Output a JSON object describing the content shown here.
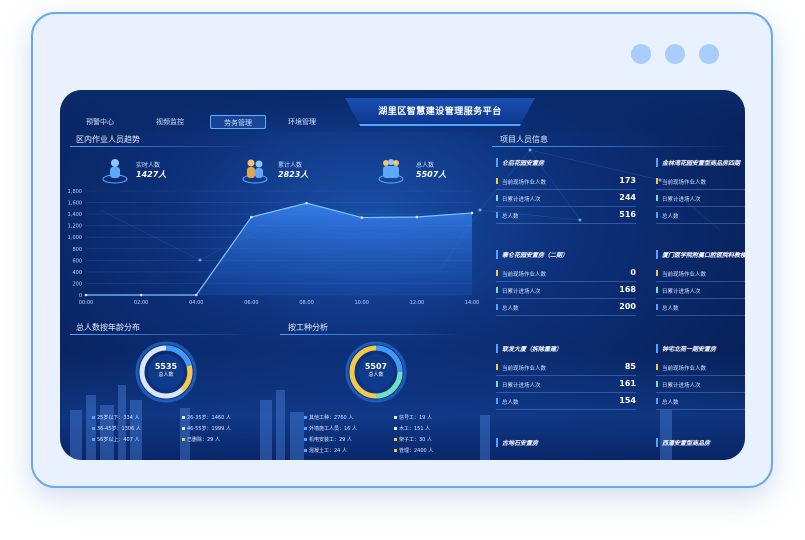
{
  "title": "湖里区智慧建设管理服务平台",
  "tabs": [
    "预警中心",
    "视频监控",
    "劳务管理",
    "环境管理"
  ],
  "active_tab": "劳务管理",
  "trend": {
    "section_title": "区内作业人员趋势",
    "stats": [
      {
        "label": "实时人数",
        "value": "1427人"
      },
      {
        "label": "累计人数",
        "value": "2823人"
      },
      {
        "label": "总人数",
        "value": "5507人"
      }
    ]
  },
  "chart_data": {
    "type": "area",
    "categories": [
      "00:00",
      "02:00",
      "04:00",
      "06:00",
      "08:00",
      "10:00",
      "12:00",
      "14:00"
    ],
    "values": [
      0,
      0,
      0,
      1350,
      1590,
      1340,
      1350,
      1420
    ],
    "yticks": [
      "0",
      "200",
      "400",
      "600",
      "800",
      "1,000",
      "1,200",
      "1,400",
      "1,600",
      "1,800"
    ],
    "ylim": [
      0,
      1800
    ],
    "grid": true
  },
  "age": {
    "section_title": "总人数按年龄分布",
    "total": "5535",
    "total_label": "总人数",
    "legend": [
      {
        "label": "25岁以下：334 人",
        "color": "#4ea4ff"
      },
      {
        "label": "26-35岁：1460 人",
        "color": "#e8edf5"
      },
      {
        "label": "36-45岁：1306 人",
        "color": "#4ea4ff"
      },
      {
        "label": "46-55岁：1999 人",
        "color": "#e8edf5"
      },
      {
        "label": "56岁以上：407 人",
        "color": "#4ea4ff"
      },
      {
        "label": "已删除：29 人",
        "color": "#f4c84a"
      }
    ]
  },
  "work": {
    "section_title": "按工种分析",
    "total": "5507",
    "total_label": "总人数",
    "legend": [
      {
        "label": "其他工种：2760 人",
        "color": "#4ea4ff"
      },
      {
        "label": "信号工：19 人",
        "color": "#e8edf5"
      },
      {
        "label": "外墙施工人员：16 人",
        "color": "#4ea4ff"
      },
      {
        "label": "木工：151 人",
        "color": "#e8edf5"
      },
      {
        "label": "机电安装工：29 人",
        "color": "#4ea4ff"
      },
      {
        "label": "架子工：30 人",
        "color": "#f4c84a"
      },
      {
        "label": "混凝土工：24 人",
        "color": "#4ea4ff"
      },
      {
        "label": "管理：2400 人",
        "color": "#f4c84a"
      }
    ]
  },
  "projects": {
    "section_title": "项目人员信息",
    "row_labels": [
      "当前现场作业人数",
      "日累计进场人次",
      "总人数"
    ],
    "left": [
      {
        "name": "仑后花园安置房",
        "values": [
          "173",
          "244",
          "516"
        ]
      },
      {
        "name": "寨仑花园安置房（二期）",
        "values": [
          "0",
          "168",
          "200"
        ]
      },
      {
        "name": "联发大厦（拆除重建）",
        "values": [
          "85",
          "161",
          "154"
        ]
      },
      {
        "name": "古地石安置房",
        "values": []
      }
    ],
    "right": [
      {
        "name": "金林湾花园安置型商品房四期",
        "values": [
          "",
          "",
          ""
        ]
      },
      {
        "name": "厦门医学院附属口腔医院科教楼",
        "values": [
          "",
          "",
          ""
        ]
      },
      {
        "name": "钟宅北苑一期安置房",
        "values": [
          "",
          "",
          ""
        ]
      },
      {
        "name": "西潘安置型商品房",
        "values": []
      }
    ]
  }
}
